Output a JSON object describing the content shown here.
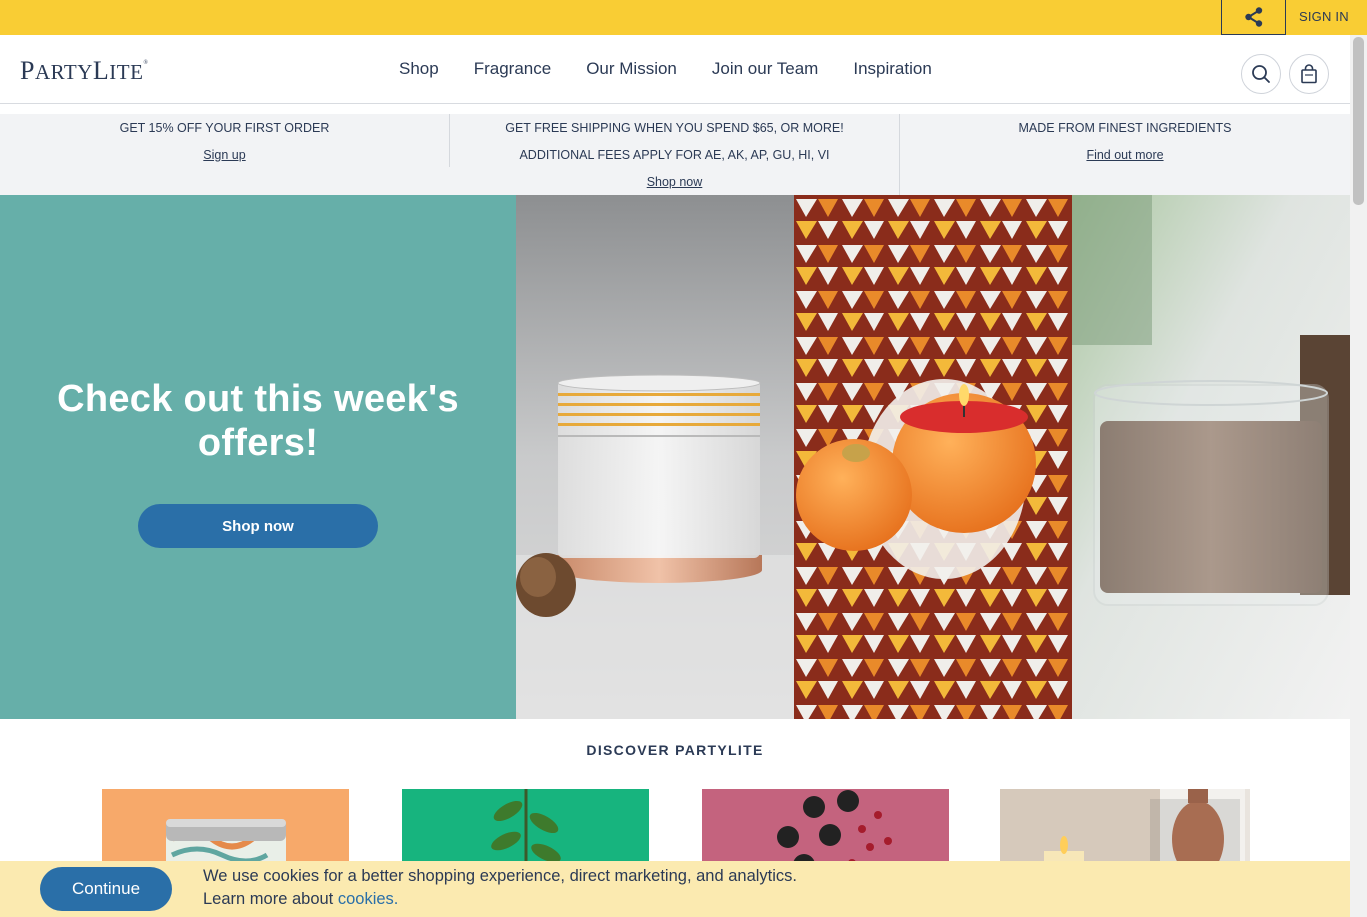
{
  "topbar": {
    "signin_label": "SIGN IN"
  },
  "header": {
    "logo_party": "P",
    "logo_arty": "ARTY",
    "logo_l": "L",
    "logo_ite": "ITE",
    "logo_mark": "®",
    "nav": [
      "Shop",
      "Fragrance",
      "Our Mission",
      "Join our Team",
      "Inspiration"
    ]
  },
  "promo": [
    {
      "lines": [
        "GET 15% OFF YOUR FIRST ORDER"
      ],
      "link": "Sign up"
    },
    {
      "lines": [
        "GET FREE SHIPPING WHEN YOU SPEND $65, OR MORE!",
        "ADDITIONAL FEES APPLY FOR AE, AK, AP, GU, HI, VI"
      ],
      "link": "Shop now"
    },
    {
      "lines": [
        "MADE FROM FINEST INGREDIENTS"
      ],
      "link": "Find out more"
    }
  ],
  "hero": {
    "title": "Check out this week's offers!",
    "button_label": "Shop now"
  },
  "discover": {
    "heading": "DISCOVER PARTYLITE"
  },
  "cookie": {
    "button_label": "Continue",
    "line1": "We use cookies for a better shopping experience, direct marketing, and analytics.",
    "line2_prefix": "Learn more about ",
    "link": "cookies."
  },
  "colors": {
    "accent_yellow": "#f9cd34",
    "brand_navy": "#2b3a55",
    "button_blue": "#2a6fa8",
    "hero_teal": "#66afa9",
    "cookie_bg": "#fbeab0"
  },
  "icons": [
    "share-icon",
    "search-icon",
    "shopping-bag-icon"
  ]
}
